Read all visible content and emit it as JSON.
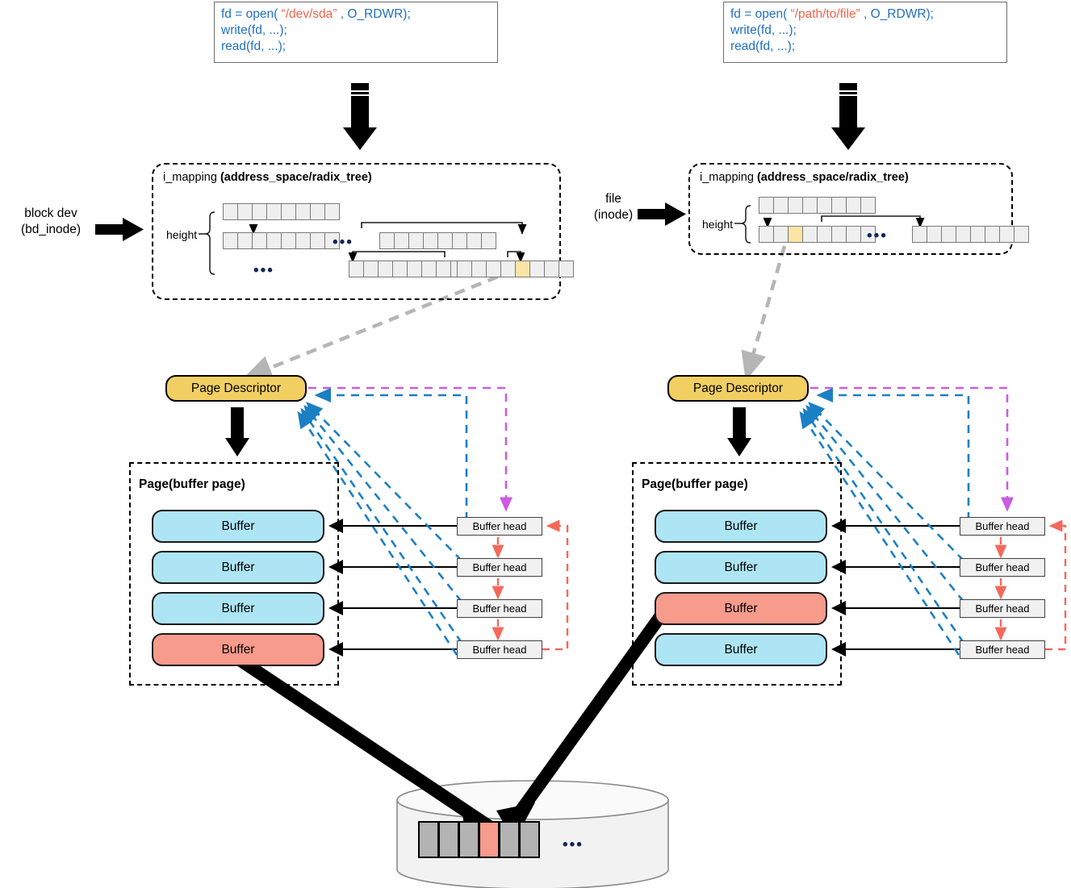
{
  "title": "Linux page cache / buffer page diagram",
  "colors": {
    "code_blue": "#1F6FC4",
    "code_string_red": "#F4624A",
    "page_descriptor_yellow": "#F2CF63",
    "buffer_blue": "#AEE5F5",
    "buffer_red": "#F79B8C",
    "radix_highlight": "#FBE5A6",
    "buffer_head_gray": "#F1F1F1",
    "disk_block_gray": "#B3B3B3",
    "bh_link_red": "#F4685A",
    "bh_to_page_blue": "#1B7FC4",
    "page_to_bh_purple": "#CC5BE0",
    "radix_to_page_gray": "#B5B5B5"
  },
  "left": {
    "code": {
      "line1_pre": "fd = open(",
      "line1_str": "“/dev/sda”",
      "line1_post": ", O_RDWR);",
      "line2": "write(fd, ...);",
      "line3": "read(fd, ...);"
    },
    "side_label_line1": "block dev",
    "side_label_line2": "(bd_inode)",
    "mapping_title_plain": "i_mapping ",
    "mapping_title_bold": "(address_space/radix_tree)",
    "height_label": "height",
    "radix_dots_middle": "•••",
    "radix_dots_bottom": "•••",
    "page_descriptor_label": "Page Descriptor",
    "page_box_title": "Page(buffer page)",
    "buffers": [
      {
        "label": "Buffer",
        "state": "clean"
      },
      {
        "label": "Buffer",
        "state": "clean"
      },
      {
        "label": "Buffer",
        "state": "clean"
      },
      {
        "label": "Buffer",
        "state": "dirty"
      }
    ],
    "buffer_heads": [
      "Buffer head",
      "Buffer head",
      "Buffer head",
      "Buffer head"
    ]
  },
  "right": {
    "code": {
      "line1_pre": "fd = open(",
      "line1_str": "“/path/to/file”",
      "line1_post": ", O_RDWR);",
      "line2": "write(fd, ...);",
      "line3": "read(fd, ...);"
    },
    "side_label_line1": "file",
    "side_label_line2": "(inode)",
    "mapping_title_plain": "i_mapping ",
    "mapping_title_bold": "(address_space/radix_tree)",
    "height_label": "height",
    "radix_dots_middle": "•••",
    "page_descriptor_label": "Page Descriptor",
    "page_box_title": "Page(buffer page)",
    "buffers": [
      {
        "label": "Buffer",
        "state": "clean"
      },
      {
        "label": "Buffer",
        "state": "clean"
      },
      {
        "label": "Buffer",
        "state": "dirty"
      },
      {
        "label": "Buffer",
        "state": "clean"
      }
    ],
    "buffer_heads": [
      "Buffer head",
      "Buffer head",
      "Buffer head",
      "Buffer head"
    ]
  },
  "disk": {
    "blocks": [
      "gray",
      "gray",
      "gray",
      "red",
      "gray",
      "gray"
    ],
    "dots": "•••"
  }
}
